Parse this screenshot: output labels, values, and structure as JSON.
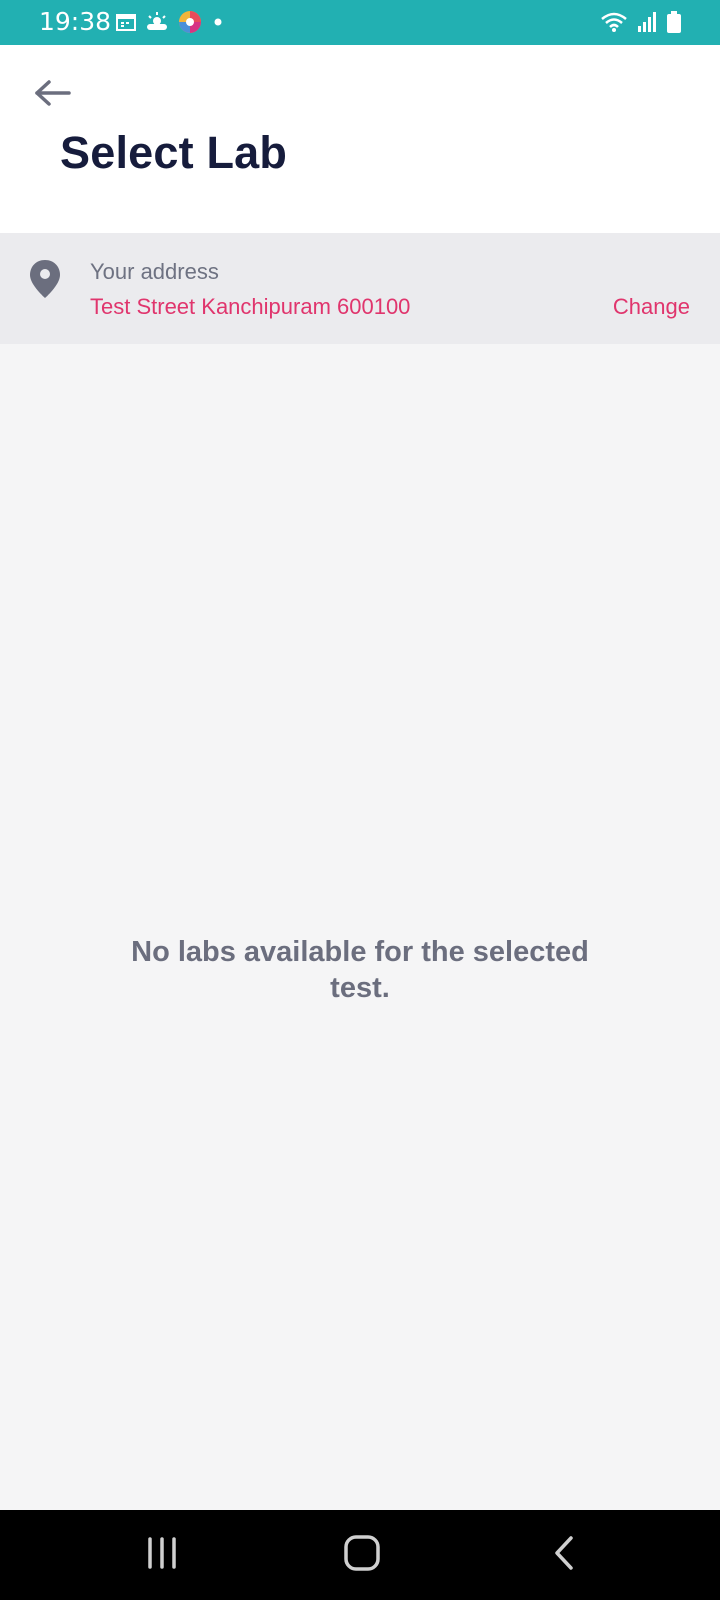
{
  "status_bar": {
    "time": "19:38",
    "left_icons": [
      "calendar-icon",
      "weather-icon",
      "app-icon",
      "notification-dot-icon"
    ],
    "right_icons": [
      "wifi-icon",
      "signal-icon",
      "battery-icon"
    ],
    "background": "#22b0b2"
  },
  "header": {
    "title": "Select Lab",
    "back_icon": "arrow-left-icon"
  },
  "address": {
    "label": "Your address",
    "value": "Test Street Kanchipuram 600100",
    "change_label": "Change",
    "icon": "location-pin-icon",
    "accent_color": "#e0356d"
  },
  "content": {
    "empty_message": "No labs available for the selected test."
  },
  "nav_bar": {
    "buttons": [
      "recent-apps-icon",
      "home-icon",
      "back-icon"
    ]
  }
}
